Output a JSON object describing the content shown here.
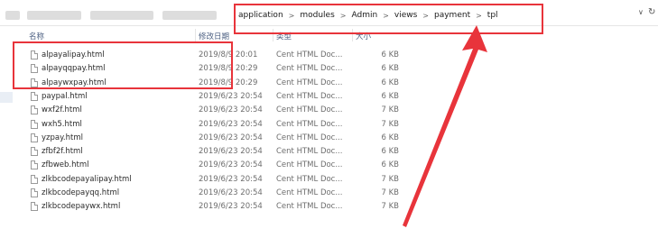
{
  "address": {
    "crumbs": [
      "application",
      "modules",
      "Admin",
      "views",
      "payment",
      "tpl"
    ]
  },
  "columns": {
    "name": "名称",
    "modified": "修改日期",
    "type": "类型",
    "size": "大小"
  },
  "files": [
    {
      "name": "alpayalipay.html",
      "date": "2019/8/9 20:01",
      "type": "Cent HTML Doc...",
      "size": "6 KB"
    },
    {
      "name": "alpayqqpay.html",
      "date": "2019/8/9 20:29",
      "type": "Cent HTML Doc...",
      "size": "6 KB"
    },
    {
      "name": "alpaywxpay.html",
      "date": "2019/8/9 20:29",
      "type": "Cent HTML Doc...",
      "size": "6 KB"
    },
    {
      "name": "paypal.html",
      "date": "2019/6/23 20:54",
      "type": "Cent HTML Doc...",
      "size": "6 KB"
    },
    {
      "name": "wxf2f.html",
      "date": "2019/6/23 20:54",
      "type": "Cent HTML Doc...",
      "size": "7 KB"
    },
    {
      "name": "wxh5.html",
      "date": "2019/6/23 20:54",
      "type": "Cent HTML Doc...",
      "size": "7 KB"
    },
    {
      "name": "yzpay.html",
      "date": "2019/6/23 20:54",
      "type": "Cent HTML Doc...",
      "size": "6 KB"
    },
    {
      "name": "zfbf2f.html",
      "date": "2019/6/23 20:54",
      "type": "Cent HTML Doc...",
      "size": "6 KB"
    },
    {
      "name": "zfbweb.html",
      "date": "2019/6/23 20:54",
      "type": "Cent HTML Doc...",
      "size": "6 KB"
    },
    {
      "name": "zlkbcodepayalipay.html",
      "date": "2019/6/23 20:54",
      "type": "Cent HTML Doc...",
      "size": "7 KB"
    },
    {
      "name": "zlkbcodepayqq.html",
      "date": "2019/6/23 20:54",
      "type": "Cent HTML Doc...",
      "size": "7 KB"
    },
    {
      "name": "zlkbcodepaywx.html",
      "date": "2019/6/23 20:54",
      "type": "Cent HTML Doc...",
      "size": "7 KB"
    }
  ],
  "icons": {
    "dropdown": "chevron-down-icon",
    "refresh": "refresh-icon",
    "file": "html-file-icon"
  },
  "colors": {
    "annotation": "#e8343b",
    "header_text": "#4d6082"
  }
}
